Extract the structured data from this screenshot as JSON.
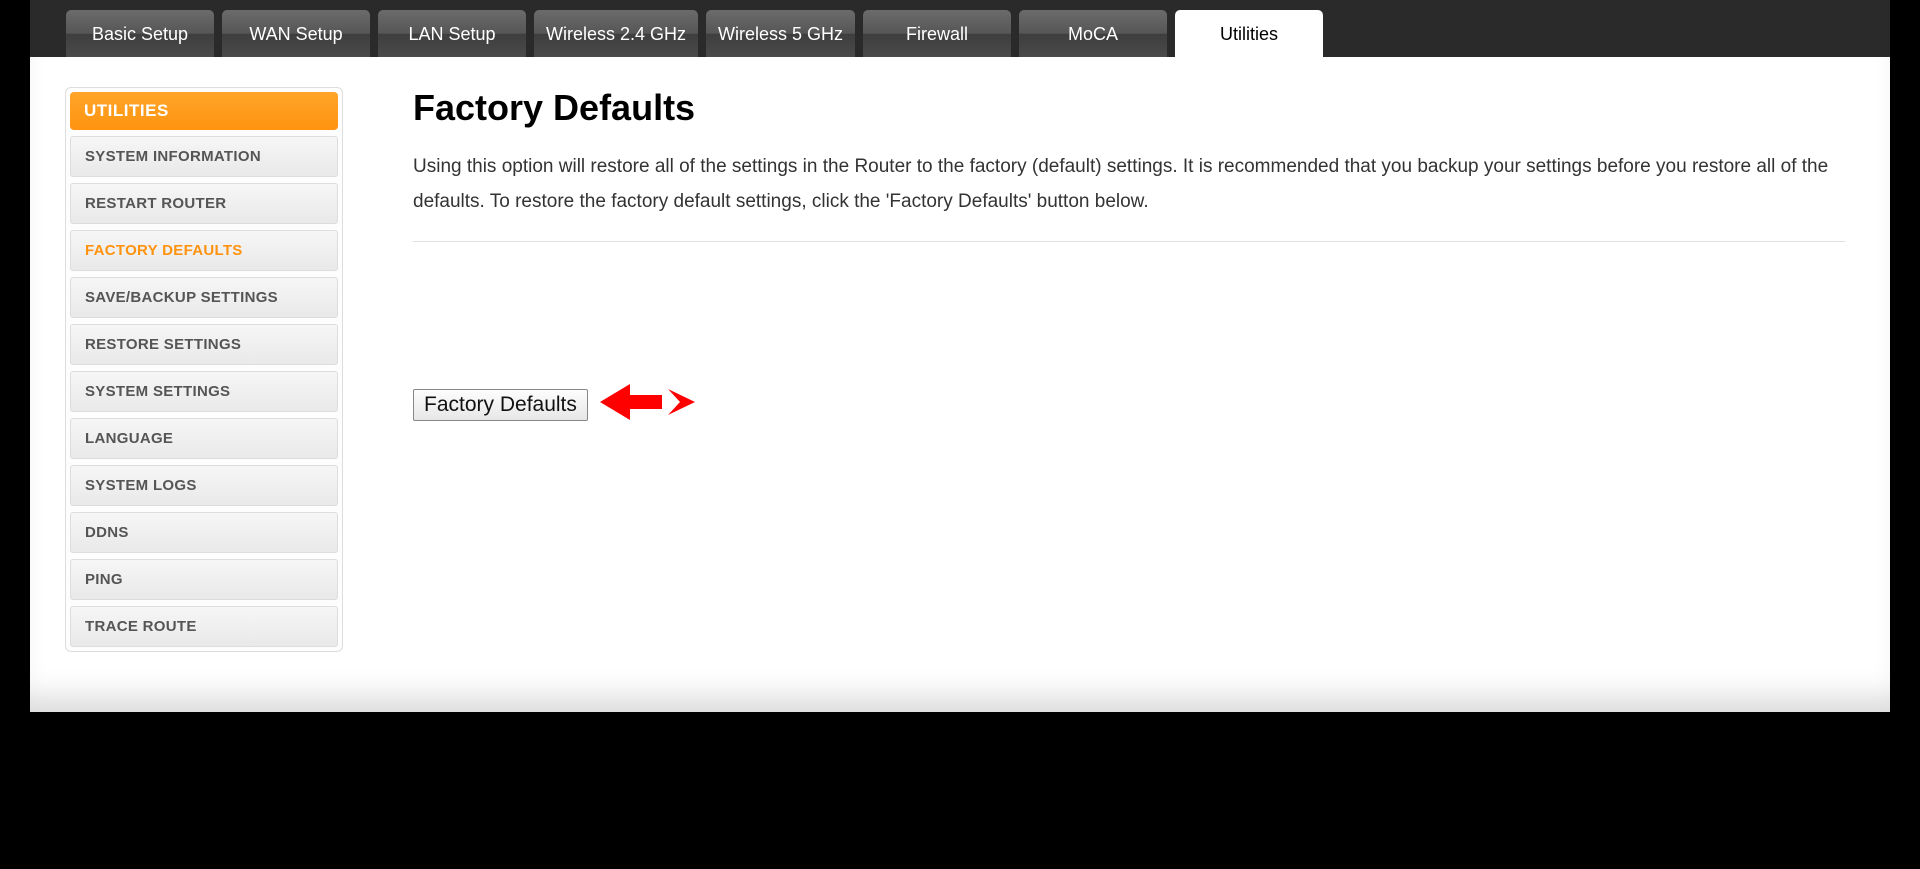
{
  "tabs": [
    {
      "label": "Basic Setup"
    },
    {
      "label": "WAN Setup"
    },
    {
      "label": "LAN Setup"
    },
    {
      "label": "Wireless 2.4 GHz"
    },
    {
      "label": "Wireless 5 GHz"
    },
    {
      "label": "Firewall"
    },
    {
      "label": "MoCA"
    },
    {
      "label": "Utilities",
      "active": true
    }
  ],
  "sidebar": {
    "header": "UTILITIES",
    "items": [
      {
        "label": "SYSTEM INFORMATION"
      },
      {
        "label": "RESTART ROUTER"
      },
      {
        "label": "FACTORY DEFAULTS",
        "active": true
      },
      {
        "label": "SAVE/BACKUP SETTINGS"
      },
      {
        "label": "RESTORE SETTINGS"
      },
      {
        "label": "SYSTEM SETTINGS"
      },
      {
        "label": "LANGUAGE"
      },
      {
        "label": "SYSTEM LOGS"
      },
      {
        "label": "DDNS"
      },
      {
        "label": "PING"
      },
      {
        "label": "TRACE ROUTE"
      }
    ]
  },
  "page": {
    "title": "Factory Defaults",
    "description": "Using this option will restore all of the settings in the Router to the factory (default) settings. It is recommended that you backup your settings before you restore all of the defaults. To restore the factory default settings, click the 'Factory Defaults' button below.",
    "button_label": "Factory Defaults"
  },
  "colors": {
    "accent": "#ff930f",
    "annotation": "#ff0000"
  }
}
